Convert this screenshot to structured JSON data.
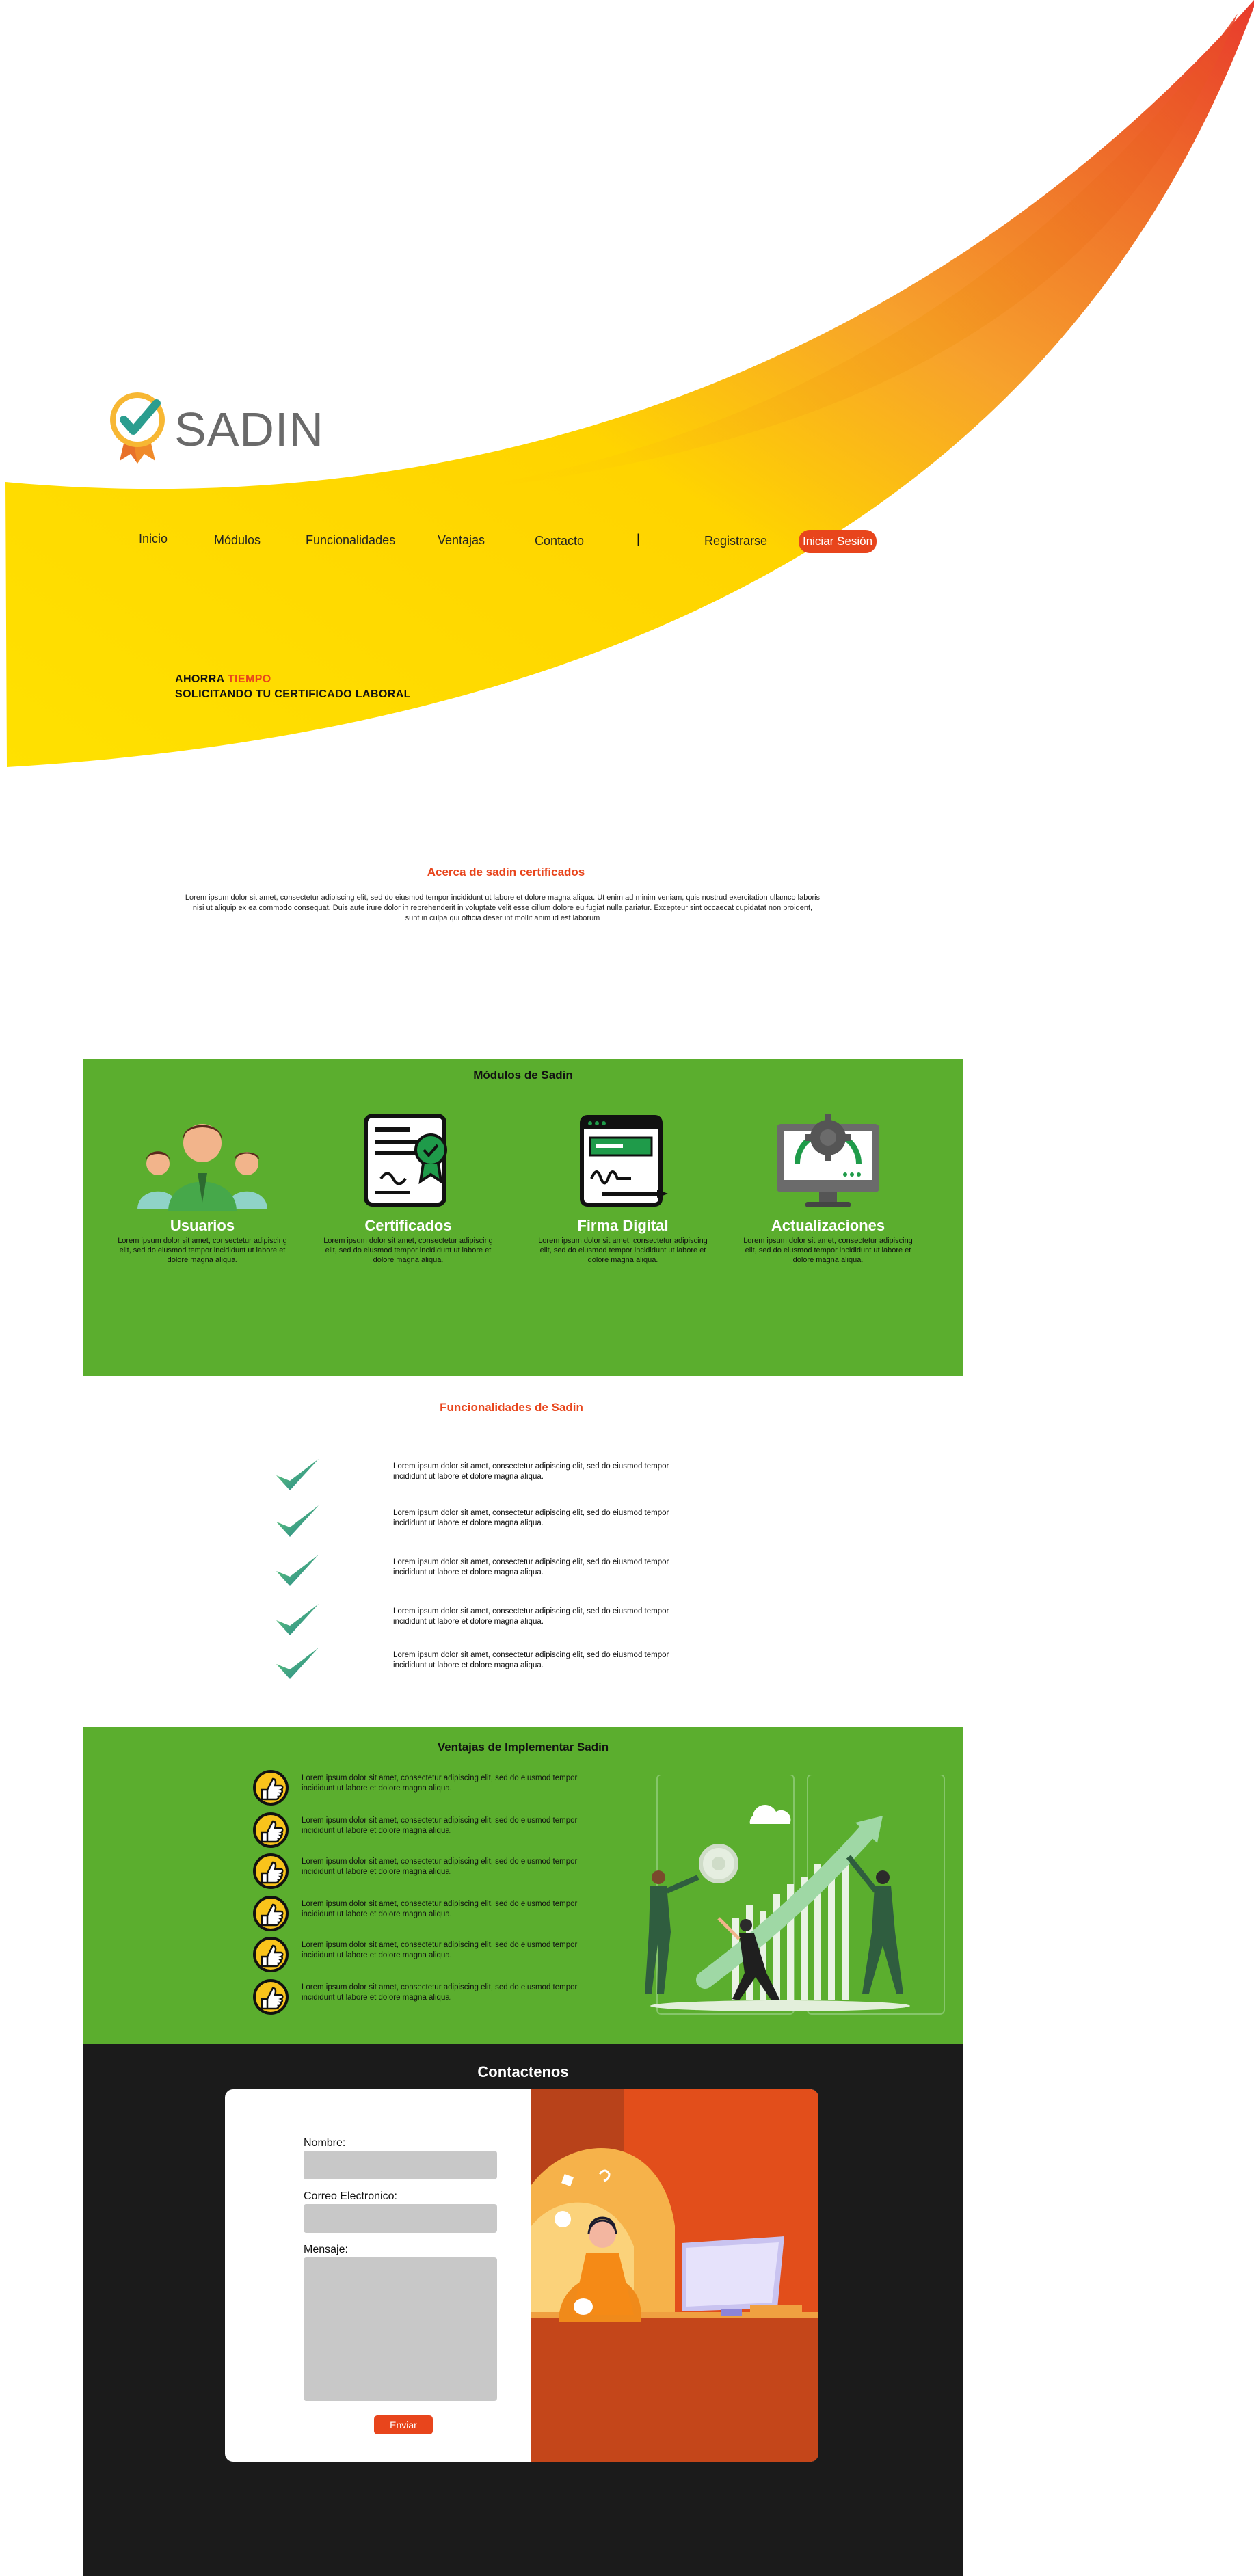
{
  "brand": {
    "name": "SADIN"
  },
  "nav": {
    "items": [
      "Inicio",
      "Módulos",
      "Funcionalidades",
      "Ventajas",
      "Contacto"
    ],
    "separator": "|",
    "register": "Registrarse",
    "login": "Iniciar Sesión"
  },
  "hero": {
    "line1_a": "AHORRA ",
    "line1_b": "TIEMPO",
    "line2": "SOLICITANDO TU CERTIFICADO LABORAL"
  },
  "about": {
    "title": "Acerca de sadin certificados",
    "text": "Lorem ipsum dolor sit amet, consectetur adipiscing elit, sed do eiusmod tempor incididunt ut labore et dolore magna aliqua. Ut enim ad minim veniam, quis nostrud exercitation ullamco laboris nisi ut aliquip ex ea commodo consequat. Duis aute irure dolor in reprehenderit in voluptate velit esse cillum dolore eu fugiat nulla pariatur. Excepteur sint occaecat cupidatat non proident, sunt in culpa qui officia deserunt mollit anim id est laborum"
  },
  "modulos": {
    "title": "Módulos de Sadin",
    "items": [
      {
        "name": "Usuarios",
        "desc": "Lorem ipsum dolor sit amet, consectetur adipiscing elit, sed do eiusmod tempor incididunt ut labore et dolore magna aliqua."
      },
      {
        "name": "Certificados",
        "desc": "Lorem ipsum dolor sit amet, consectetur adipiscing elit, sed do eiusmod tempor incididunt ut labore et dolore magna aliqua."
      },
      {
        "name": "Firma Digital",
        "desc": "Lorem ipsum dolor sit amet, consectetur adipiscing elit, sed do eiusmod tempor incididunt ut labore et dolore magna aliqua."
      },
      {
        "name": "Actualizaciones",
        "desc": "Lorem ipsum dolor sit amet, consectetur adipiscing elit, sed do eiusmod tempor incididunt ut labore et dolore magna aliqua."
      }
    ]
  },
  "funcionalidades": {
    "title": "Funcionalidades de Sadin",
    "items": [
      "Lorem ipsum dolor sit amet, consectetur adipiscing elit, sed do eiusmod tempor incididunt ut labore et dolore magna aliqua.",
      "Lorem ipsum dolor sit amet, consectetur adipiscing elit, sed do eiusmod tempor incididunt ut labore et dolore magna aliqua.",
      "Lorem ipsum dolor sit amet, consectetur adipiscing elit, sed do eiusmod tempor incididunt ut labore et dolore magna aliqua.",
      "Lorem ipsum dolor sit amet, consectetur adipiscing elit, sed do eiusmod tempor incididunt ut labore et dolore magna aliqua.",
      "Lorem ipsum dolor sit amet, consectetur adipiscing elit, sed do eiusmod tempor incididunt ut labore et dolore magna aliqua."
    ]
  },
  "ventajas": {
    "title": "Ventajas de Implementar Sadin",
    "items": [
      "Lorem ipsum dolor sit amet, consectetur adipiscing elit, sed do eiusmod tempor incididunt ut labore et dolore magna aliqua.",
      "Lorem ipsum dolor sit amet, consectetur adipiscing elit, sed do eiusmod tempor incididunt ut labore et dolore magna aliqua.",
      "Lorem ipsum dolor sit amet, consectetur adipiscing elit, sed do eiusmod tempor incididunt ut labore et dolore magna aliqua.",
      "Lorem ipsum dolor sit amet, consectetur adipiscing elit, sed do eiusmod tempor incididunt ut labore et dolore magna aliqua.",
      "Lorem ipsum dolor sit amet, consectetur adipiscing elit, sed do eiusmod tempor incididunt ut labore et dolore magna aliqua.",
      "Lorem ipsum dolor sit amet, consectetur adipiscing elit, sed do eiusmod tempor incididunt ut labore et dolore magna aliqua."
    ]
  },
  "contacto": {
    "title": "Contactenos",
    "name_label": "Nombre:",
    "email_label": "Correo Electronico:",
    "message_label": "Mensaje:",
    "name_value": "",
    "email_value": "",
    "message_value": "",
    "submit": "Enviar"
  },
  "colors": {
    "accent": "#e8451c",
    "green": "#5bae2e",
    "yellow": "#ffe100",
    "dark": "#1b1b1b"
  },
  "icons": [
    "logo-check-icon",
    "users-icon",
    "certificate-icon",
    "signature-icon",
    "settings-monitor-icon",
    "check-icon",
    "thumbs-up-badge-icon",
    "team-growth-illustration",
    "support-agent-illustration"
  ]
}
